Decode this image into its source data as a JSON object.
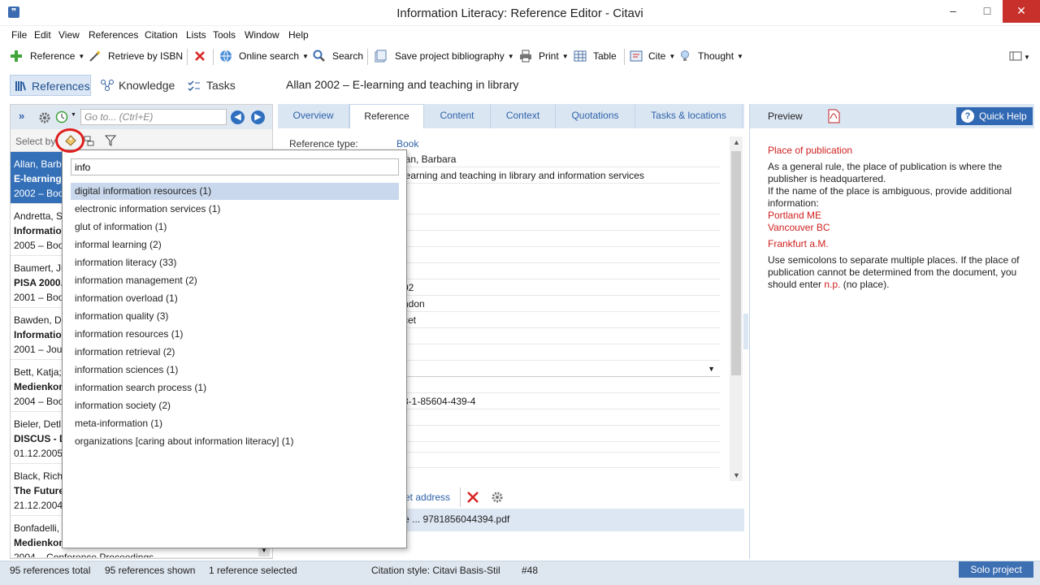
{
  "window": {
    "title": "Information Literacy: Reference Editor - Citavi"
  },
  "menu": [
    "File",
    "Edit",
    "View",
    "References",
    "Citation",
    "Lists",
    "Tools",
    "Window",
    "Help"
  ],
  "toolbar": {
    "reference": "Reference",
    "retrieve_isbn": "Retrieve by ISBN",
    "online_search": "Online search",
    "search": "Search",
    "save_bibliography": "Save project bibliography",
    "print": "Print",
    "table": "Table",
    "cite": "Cite",
    "thought": "Thought"
  },
  "nav_tabs": [
    "References",
    "Knowledge",
    "Tasks"
  ],
  "reference_heading": "Allan 2002 – E-learning and teaching in library",
  "left_panel": {
    "goto_placeholder": "Go to... (Ctrl+E)",
    "select_by": "Select by",
    "items": [
      {
        "author": "Allan, Barb",
        "title": "E-learning",
        "meta": "2002 – Boo"
      },
      {
        "author": "Andretta, S",
        "title": "Informatio",
        "meta": "2005 – Boo"
      },
      {
        "author": "Baumert, Jü",
        "title": "PISA 2000.",
        "meta": "2001 – Boo"
      },
      {
        "author": "Bawden, D",
        "title": "Informatio",
        "meta": "2001 – Jou"
      },
      {
        "author": "Bett, Katja;",
        "title": "Medienkon",
        "meta": "2004 – Boo"
      },
      {
        "author": "Bieler, Detl",
        "title": "DISCUS - D",
        "meta": "01.12.2005"
      },
      {
        "author": "Black, Rich",
        "title": "The Future",
        "meta": "21.12.2004"
      },
      {
        "author": "Bonfadelli,",
        "title": "Medienkom",
        "meta": "2004 – Conference Proceedings"
      }
    ]
  },
  "center": {
    "tabs": [
      "Overview",
      "Reference",
      "Content",
      "Context",
      "Quotations",
      "Tasks & locations"
    ],
    "active_tab": "Reference",
    "reference_type_label": "Reference type:",
    "reference_type_value": "Book",
    "field_values": [
      "lan, Barbara",
      "learning and teaching in library and information services",
      "",
      "",
      "",
      "",
      "",
      "02",
      "ndon",
      "cet",
      "",
      "",
      "",
      "8-1-85604-439-4"
    ],
    "attachment_link": "et address",
    "attachment_file": "y.de ... 9781856044394.pdf"
  },
  "right_panel": {
    "preview_label": "Preview",
    "quick_help_label": "Quick Help",
    "help_title": "Place of publication",
    "help_paragraph_1": "As a general rule, the place of publication is where the publisher is headquartered.",
    "help_paragraph_2": "If the name of the place is ambiguous, provide additional information:",
    "help_examples": [
      "Portland ME",
      "Vancouver BC",
      "Frankfurt a.M."
    ],
    "help_paragraph_3a": "Use semicolons to separate multiple places. If the place of publication cannot be determined from the document, you should enter ",
    "help_np": "n.p.",
    "help_paragraph_3b": " (no place)."
  },
  "popup": {
    "search_value": "info",
    "keywords": [
      "digital information resources (1)",
      "electronic information services (1)",
      "glut of information (1)",
      "informal learning (2)",
      "information literacy (33)",
      "information management (2)",
      "information overload (1)",
      "information quality (3)",
      "information resources (1)",
      "information retrieval (2)",
      "information sciences (1)",
      "information search process (1)",
      "information society (2)",
      "meta-information (1)",
      "organizations [caring about information literacy] (1)"
    ],
    "selected_index": 0
  },
  "status": {
    "total": "95 references total",
    "shown": "95 references shown",
    "selected": "1 reference selected",
    "citation_style": "Citation style: Citavi Basis-Stil",
    "number": "#48",
    "solo": "Solo project"
  },
  "colors": {
    "accent": "#3470b8",
    "tab_bg": "#dbe6f3",
    "help_red": "#cf1f1f",
    "close_red": "#c7302b"
  }
}
